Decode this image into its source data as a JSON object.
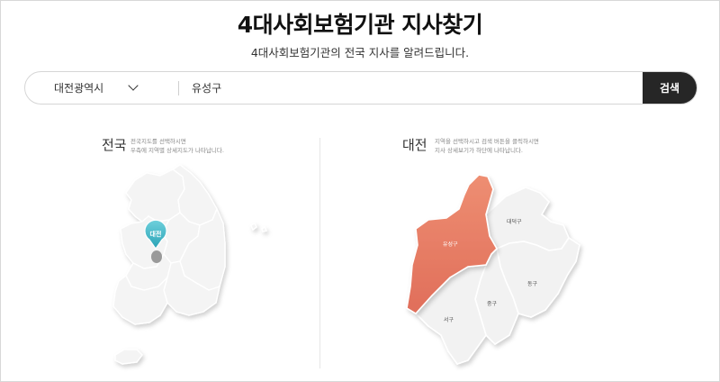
{
  "header": {
    "title": "4대사회보험기관 지사찾기",
    "subtitle": "4대사회보험기관의 전국 지사를 알려드립니다."
  },
  "search": {
    "region_value": "대전광역시",
    "district_value": "유성구",
    "button_label": "검색"
  },
  "national_panel": {
    "title": "전국",
    "hint_line1": "전국지도를 선택하시면",
    "hint_line2": "우측에 지역별 상세지도가 나타납니다.",
    "marker_label": "대전"
  },
  "city_panel": {
    "title": "대전",
    "hint_line1": "지역을 선택하시고 검색 버튼을 클릭하시면",
    "hint_line2": "지사 상세보기가 하단에 나타납니다.",
    "districts": [
      "유성구",
      "대덕구",
      "동구",
      "중구",
      "서구"
    ],
    "selected_district": "유성구"
  },
  "colors": {
    "selected_district": "#e8826a",
    "marker": "#41b6c8",
    "search_button": "#262626"
  }
}
